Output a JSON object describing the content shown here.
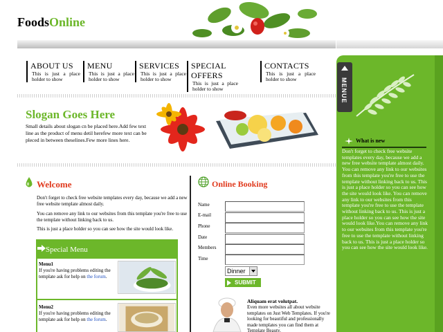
{
  "logo": {
    "part1": "Foods",
    "part2": "Online"
  },
  "colors": {
    "accent_green": "#6cb72a",
    "heading_red": "#e03a1e",
    "link_blue": "#1f4fbf"
  },
  "nav": [
    {
      "label": "ABOUT US",
      "sub": "This is just a place holder to show"
    },
    {
      "label": "MENU",
      "sub": "This is just a place holder to show"
    },
    {
      "label": "SERVICES",
      "sub": "This is just a place holder to show"
    },
    {
      "label": "SPECIAL OFFERS",
      "sub": "This is just a place holder to show"
    },
    {
      "label": "CONTACTS",
      "sub": "This is just a place holder to show"
    }
  ],
  "slogan": {
    "title": "Slogan Goes Here",
    "text": "Small details about slogan cn be placed here.Add few text line as the product of menu detil herefew more text can be pleced in between theselines.Few more lines here."
  },
  "sidebar": {
    "tab_label": "MENUE",
    "whats_new_title": "What is new",
    "whats_new_text": "Don't forget to check free website templates every day, because we add a new free website template almost daily. You can remove any link to our websites from this template you're free to use the template without linking back to us. This is just a place holder so you can see how the site would look like. You can remove any link to our websites from this template you're free to use the template without linking back to us. This is just a place holder so you can see how the site would look like.You can remove any link to our websites from this template you're free to use the template without linking back to us. This is just a place holder so you can see how the site would look like."
  },
  "welcome": {
    "title": "Welcome",
    "p1": "Don't forget to check free website templates every day, because we add a new free website template almost daily.",
    "p2": "You can remove any link to our websites from this template you're free to use the template without linking back to us.",
    "p3": "This is just a place holder so you can see how the site would look like."
  },
  "special_menu": {
    "title": "Special Menu",
    "items": [
      {
        "name": "Menu1",
        "desc": "If you're having problems editing the template ask for help on",
        "link": "the forum",
        "end": "."
      },
      {
        "name": "Menu2",
        "desc": "If you're having problems editing the template ask for help on",
        "link": "the forum",
        "end": "."
      }
    ]
  },
  "booking": {
    "title": "Online Booking",
    "fields": [
      "Name",
      "E-mail",
      "Phone",
      "Date",
      "Members",
      "Time"
    ],
    "select_value": "Dinner",
    "submit_label": "SUBMIT"
  },
  "aliquam": {
    "title": "Aliquam erat volutpat.",
    "text": "Even more websites all about website templates on Just Web Templates. If you're looking for beautiful and professionally made templates you can find them at Template Beauty."
  }
}
